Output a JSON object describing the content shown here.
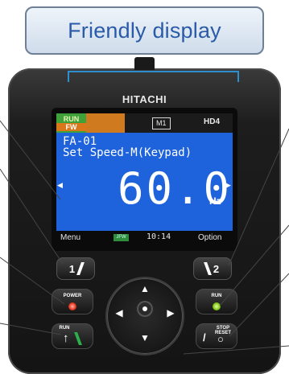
{
  "callout": {
    "title": "Friendly display"
  },
  "brand": "HITACHI",
  "lcd": {
    "run_top": "RUN",
    "run_bottom": "FW",
    "mode_tag": "M1",
    "duty_tag": "HD4",
    "param_code": "FA-01",
    "param_name": "Set Speed-M(Keypad)",
    "value": "60.00",
    "unit": "Hz",
    "left_arrow": "◀",
    "right_arrow": "▶",
    "menu": "Menu",
    "status": "JFW",
    "time": "10:14",
    "option": "Option"
  },
  "keys": {
    "f1": "1",
    "f2": "2",
    "power_label": "POWER",
    "run_key_label": "RUN",
    "run_led_label": "RUN",
    "stop_label": "STOP RESET",
    "up": "▲",
    "down": "▼",
    "left": "◀",
    "right": "▶"
  },
  "colors": {
    "lcd_blue": "#1f63dc",
    "callout_text": "#2a5ba8",
    "bracket": "#2e8fd0",
    "run_green": "#3fa13a",
    "fw_orange": "#d9771a"
  }
}
